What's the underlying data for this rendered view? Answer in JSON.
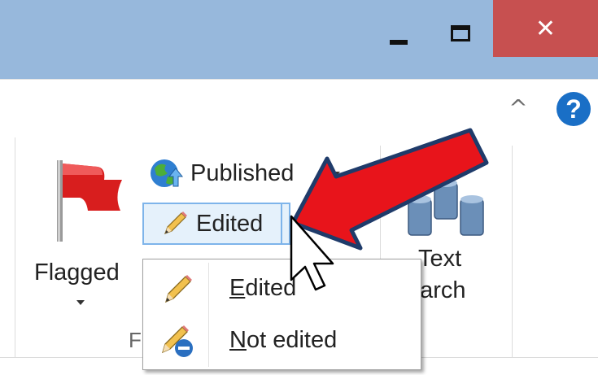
{
  "window": {
    "minimize_icon": "minimize-icon",
    "maximize_icon": "maximize-icon",
    "close_glyph": "✕",
    "titlebar_color": "#97b8dc",
    "close_color": "#c75050"
  },
  "ribbon_header": {
    "collapse_glyph": "^",
    "help_glyph": "?"
  },
  "ribbon": {
    "flagged_label": "Flagged",
    "group_label": "F",
    "published_label": "Published",
    "edited_label": "Edited",
    "text_search_line1": "Text",
    "text_search_line2": "earch"
  },
  "dropdown": {
    "items": [
      {
        "first_letter": "E",
        "rest": "dited",
        "icon": "pencil-icon"
      },
      {
        "first_letter": "N",
        "rest": "ot edited",
        "icon": "pencil-not-edited-icon"
      }
    ]
  },
  "annotation": {
    "arrow_color": "#e8141b",
    "arrow_outline": "#1f3b6a"
  }
}
